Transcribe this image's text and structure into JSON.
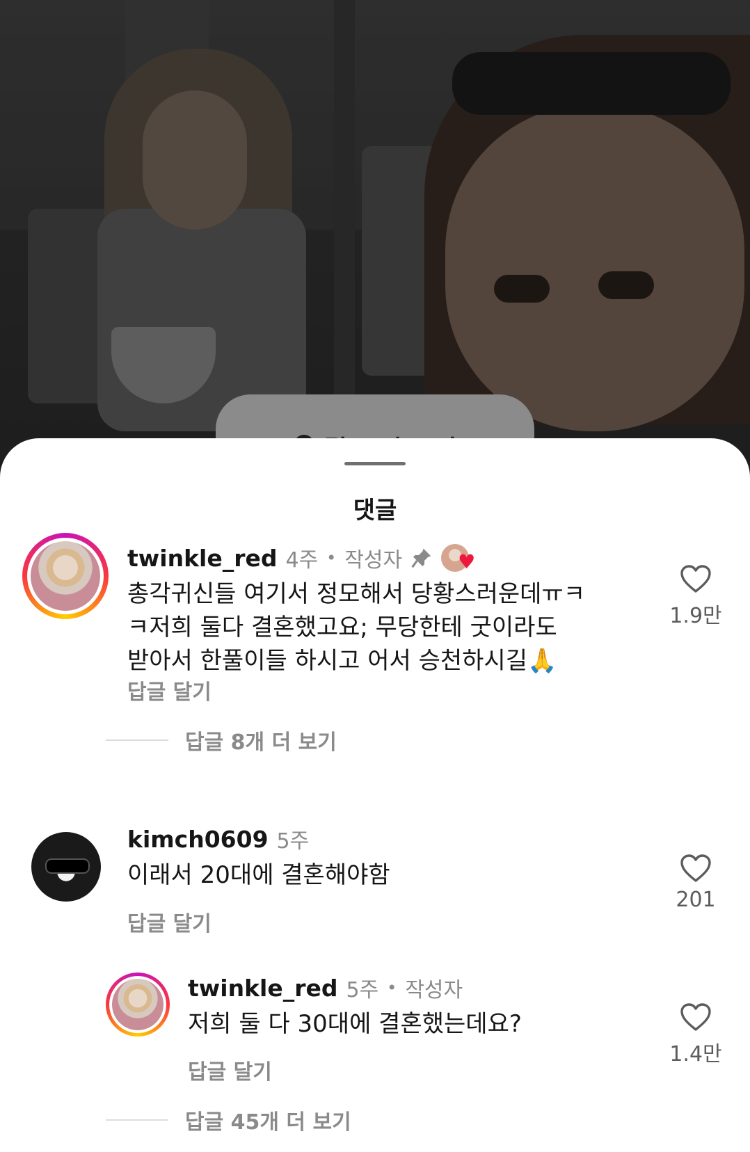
{
  "video": {
    "overlay_label": "릴스 더 보기"
  },
  "sheet": {
    "title": "댓글"
  },
  "comments": [
    {
      "username": "twinkle_red",
      "time": "4주",
      "author_tag": "작성자",
      "pinned": true,
      "liked_by_creator": true,
      "text": "총각귀신들 여기서 정모해서 당황스러운데ㅠㅋ\nㅋ저희 둘다 결혼했고요; 무당한테 굿이라도\n받아서 한풀이들 하시고 어서 승천하시길🙏",
      "reply_label": "답글 달기",
      "likes": "1.9만",
      "view_replies": "답글 8개 더 보기"
    },
    {
      "username": "kimch0609",
      "time": "5주",
      "text": "이래서 20대에 결혼해야함",
      "reply_label": "답글 달기",
      "likes": "201"
    },
    {
      "username": "twinkle_red",
      "time": "5주",
      "author_tag": "작성자",
      "text": "저희 둘 다 30대에 결혼했는데요?",
      "reply_label": "답글 달기",
      "likes": "1.4만",
      "view_replies": "답글 45개 더 보기"
    }
  ],
  "colors": {
    "sheet_bg": "#ffffff",
    "heart_red": "#f0173c",
    "muted_text": "#8a8a8a"
  }
}
